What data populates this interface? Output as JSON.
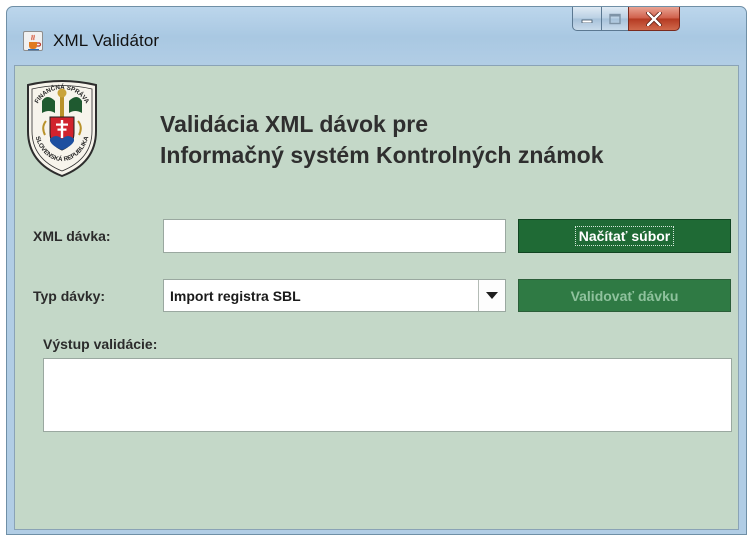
{
  "window": {
    "title": "XML Validátor",
    "icon": "java-cup-icon"
  },
  "header": {
    "emblem": "financna-sprava-emblem",
    "emblem_text_top": "FINANČNÁ SPRÁVA",
    "emblem_text_bottom": "SLOVENSKÁ REPUBLIKA",
    "title_line1": "Validácia XML dávok pre",
    "title_line2": "Informačný systém Kontrolných známok"
  },
  "form": {
    "xml_label": "XML dávka:",
    "xml_value": "",
    "load_button": "Načítať súbor",
    "type_label": "Typ dávky:",
    "type_selected": "Import registra SBL",
    "validate_button": "Validovať dávku",
    "output_label": "Výstup validácie:",
    "output_value": ""
  },
  "colors": {
    "client_background": "#c4d8c8",
    "button_primary": "#1f6a35",
    "button_disabled_text": "#8fc29d"
  }
}
